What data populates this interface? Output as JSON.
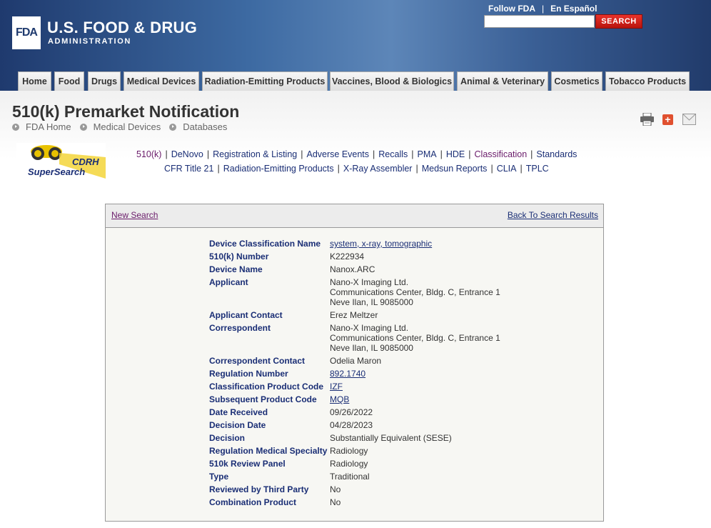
{
  "header": {
    "logo_text": "FDA",
    "agency_line1": "U.S. FOOD & DRUG",
    "agency_line2": "ADMINISTRATION",
    "follow_label": "Follow FDA",
    "follow_sep": "|",
    "spanish_label": "En Español",
    "search_placeholder": "",
    "search_button": "SEARCH"
  },
  "nav_tabs": [
    "Home",
    "Food",
    "Drugs",
    "Medical Devices",
    "Radiation-Emitting Products",
    "Vaccines, Blood & Biologics",
    "Animal & Veterinary",
    "Cosmetics",
    "Tobacco Products"
  ],
  "page": {
    "title": "510(k) Premarket Notification",
    "breadcrumbs": [
      "FDA Home",
      "Medical Devices",
      "Databases"
    ],
    "cdrh_logo_line1": "CDRH",
    "cdrh_logo_line2": "SuperSearch"
  },
  "db_links_row1": [
    "510(k)",
    "DeNovo",
    "Registration & Listing",
    "Adverse Events",
    "Recalls",
    "PMA",
    "HDE",
    "Classification",
    "Standards"
  ],
  "db_links_row2": [
    "CFR Title 21",
    "Radiation-Emitting Products",
    "X-Ray Assembler",
    "Medsun Reports",
    "CLIA",
    "TPLC"
  ],
  "link_separator": "|",
  "results": {
    "new_search": "New Search",
    "back_to_results": "Back To Search Results",
    "fields": [
      {
        "label": "Device Classification Name",
        "value": [
          "system, x-ray, tomographic"
        ],
        "link": true
      },
      {
        "label": "510(k) Number",
        "value": [
          "K222934"
        ],
        "link": false
      },
      {
        "label": "Device Name",
        "value": [
          "Nanox.ARC"
        ],
        "link": false
      },
      {
        "label": "Applicant",
        "value": [
          "Nano-X Imaging Ltd.",
          "Communications Center, Bldg. C, Entrance 1",
          "Neve Ilan,  IL 9085000"
        ],
        "link": false
      },
      {
        "label": "Applicant Contact",
        "value": [
          "Erez Meltzer"
        ],
        "link": false
      },
      {
        "label": "Correspondent",
        "value": [
          "Nano-X Imaging Ltd.",
          "Communications Center, Bldg. C, Entrance 1",
          "Neve Ilan,  IL 9085000"
        ],
        "link": false
      },
      {
        "label": "Correspondent Contact",
        "value": [
          "Odelia Maron"
        ],
        "link": false
      },
      {
        "label": "Regulation Number",
        "value": [
          "892.1740"
        ],
        "link": true
      },
      {
        "label": "Classification Product Code",
        "value": [
          "IZF"
        ],
        "link": true
      },
      {
        "label": "Subsequent Product Code",
        "value": [
          "MQB"
        ],
        "link": true
      },
      {
        "label": "Date Received",
        "value": [
          "09/26/2022"
        ],
        "link": false
      },
      {
        "label": "Decision Date",
        "value": [
          "04/28/2023"
        ],
        "link": false
      },
      {
        "label": "Decision",
        "value": [
          "Substantially Equivalent (SESE)"
        ],
        "link": false
      },
      {
        "label": "Regulation Medical Specialty",
        "value": [
          "Radiology"
        ],
        "link": false
      },
      {
        "label": "510k Review Panel",
        "value": [
          "Radiology"
        ],
        "link": false
      },
      {
        "label": "Type",
        "value": [
          "Traditional"
        ],
        "link": false
      },
      {
        "label": "Reviewed by Third Party",
        "value": [
          "No"
        ],
        "link": false
      },
      {
        "label": "Combination Product",
        "value": [
          "No"
        ],
        "link": false
      }
    ]
  },
  "colors": {
    "header_dark": "#1f3a6e",
    "link_blue": "#1a2e75",
    "visited_purple": "#6a1b6a",
    "search_red": "#d0221b"
  }
}
